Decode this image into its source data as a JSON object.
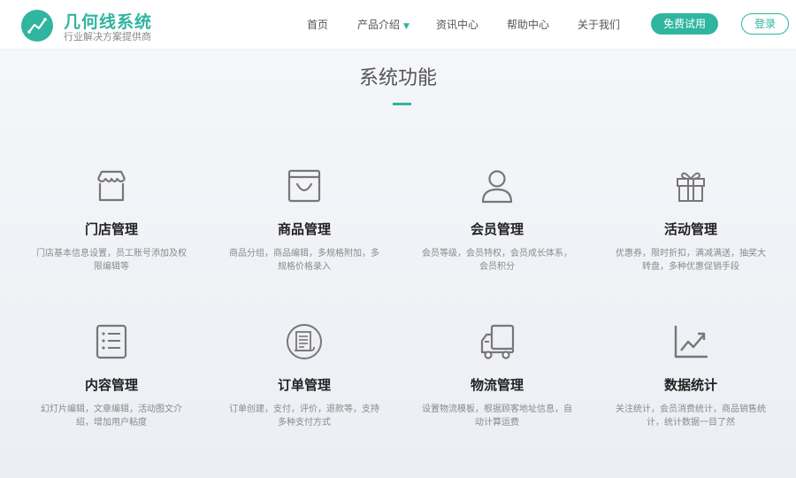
{
  "brand": {
    "name": "几何线系统",
    "slogan": "行业解决方案提供商",
    "color": "#2fb5a0"
  },
  "nav": {
    "items": [
      {
        "label": "首页"
      },
      {
        "label": "产品介绍",
        "has_dropdown": true
      },
      {
        "label": "资讯中心"
      },
      {
        "label": "帮助中心"
      },
      {
        "label": "关于我们"
      }
    ],
    "trial_label": "免费试用",
    "login_label": "登录"
  },
  "section": {
    "title": "系统功能"
  },
  "features": [
    {
      "icon": "store-icon",
      "name": "门店管理",
      "desc": "门店基本信息设置，员工账号添加及权限编辑等"
    },
    {
      "icon": "shopping-bag-icon",
      "name": "商品管理",
      "desc": "商品分组，商品编辑，多规格附加，多规格价格录入"
    },
    {
      "icon": "user-icon",
      "name": "会员管理",
      "desc": "会员等级，会员特权，会员成长体系，会员积分"
    },
    {
      "icon": "gift-icon",
      "name": "活动管理",
      "desc": "优惠券，限时折扣，满减满送，抽奖大转盘，多种优惠促销手段"
    },
    {
      "icon": "list-icon",
      "name": "内容管理",
      "desc": "幻灯片编辑，文章编辑，活动图文介绍，增加用户粘度"
    },
    {
      "icon": "order-icon",
      "name": "订单管理",
      "desc": "订单创建，支付，评价，退款等，支持多种支付方式"
    },
    {
      "icon": "truck-icon",
      "name": "物流管理",
      "desc": "设置物流模板，根据顾客地址信息，自动计算运费"
    },
    {
      "icon": "chart-icon",
      "name": "数据统计",
      "desc": "关注统计，会员消费统计，商品销售统计，统计数据一目了然"
    }
  ]
}
